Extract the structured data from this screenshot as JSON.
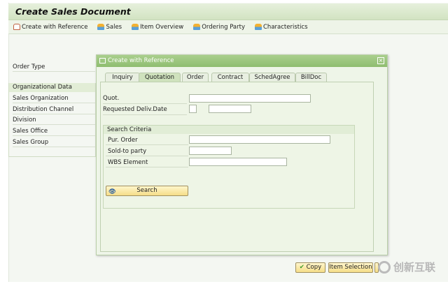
{
  "title": "Create Sales Document",
  "toolbar": [
    {
      "label": "Create with Reference",
      "icon": "copy-doc-icon"
    },
    {
      "label": "Sales",
      "icon": "person-icon"
    },
    {
      "label": "Item Overview",
      "icon": "person-icon"
    },
    {
      "label": "Ordering Party",
      "icon": "person-icon"
    },
    {
      "label": "Characteristics",
      "icon": "person-icon"
    }
  ],
  "left": {
    "order_type": "Order Type",
    "org_header": "Organizational Data",
    "fields": [
      "Sales Organization",
      "Distribution Channel",
      "Division",
      "Sales Office",
      "Sales Group"
    ]
  },
  "dialog": {
    "title": "Create with Reference",
    "close": "×",
    "tabs": [
      "Inquiry",
      "Quotation",
      "Order",
      "Contract",
      "SchedAgree",
      "BillDoc"
    ],
    "active_tab": "Quotation",
    "quot_label": "Quot.",
    "quot_value": "",
    "date_label": "Requested Deliv.Date",
    "date_value": "",
    "search": {
      "header": "Search Criteria",
      "pur_order": "Pur. Order",
      "sold_to": "Sold-to party",
      "wbs": "WBS Element",
      "button": "Search"
    },
    "buttons": {
      "copy": "Copy",
      "item_selection": "Item Selection"
    }
  },
  "watermark": "创新互联"
}
